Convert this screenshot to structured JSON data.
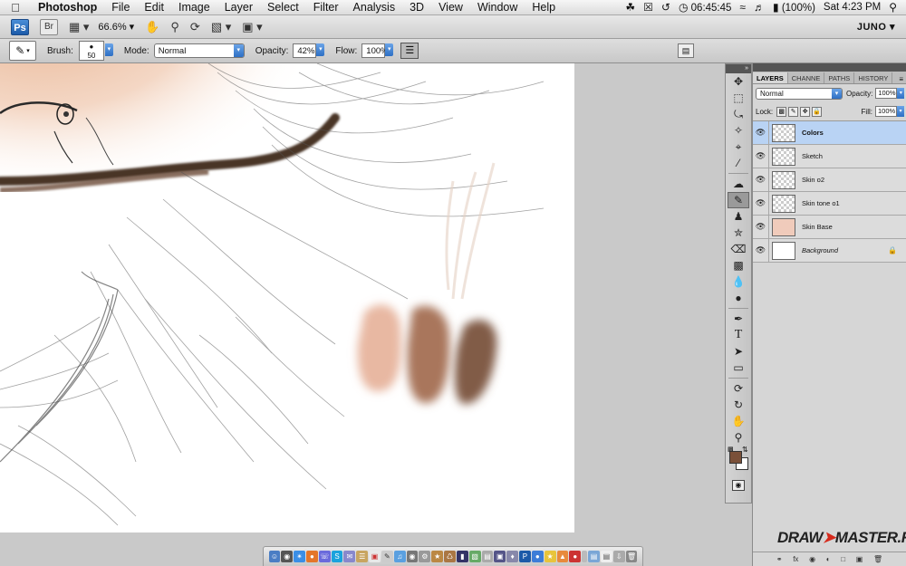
{
  "menubar": {
    "app_name": "Photoshop",
    "menus": [
      "File",
      "Edit",
      "Image",
      "Layer",
      "Select",
      "Filter",
      "Analysis",
      "3D",
      "View",
      "Window",
      "Help"
    ],
    "clock_time": "06:45:45",
    "battery": "(100%)",
    "datetime": "Sat 4:23 PM"
  },
  "appbar": {
    "ps_label": "Ps",
    "br_label": "Br",
    "zoom_level": "66.6%",
    "workspace": "JUNO"
  },
  "options": {
    "brush_label": "Brush:",
    "brush_size": "50",
    "mode_label": "Mode:",
    "mode_value": "Normal",
    "opacity_label": "Opacity:",
    "opacity_value": "42%",
    "flow_label": "Flow:",
    "flow_value": "100%"
  },
  "colors": {
    "foreground": "#7a5039",
    "background": "#ffffff",
    "swatch_light": "#e8b8a2",
    "swatch_mid": "#a9765c",
    "swatch_dark": "#815b47",
    "layer_selected": "#b9d3f4"
  },
  "layers_panel": {
    "tabs": [
      "LAYERS",
      "CHANNE",
      "PATHS",
      "HISTORY"
    ],
    "blend_mode": "Normal",
    "opacity_label": "Opacity:",
    "opacity_value": "100%",
    "lock_label": "Lock:",
    "fill_label": "Fill:",
    "fill_value": "100%",
    "layers": [
      {
        "name": "Colors",
        "selected": true,
        "thumb": "transparent"
      },
      {
        "name": "Sketch",
        "selected": false,
        "thumb": "transparent"
      },
      {
        "name": "Skin o2",
        "selected": false,
        "thumb": "transparent"
      },
      {
        "name": "Skin tone o1",
        "selected": false,
        "thumb": "transparent"
      },
      {
        "name": "Skin Base",
        "selected": false,
        "thumb": "skin"
      },
      {
        "name": "Background",
        "selected": false,
        "thumb": "white",
        "locked": true
      }
    ]
  },
  "tools": [
    "move-tool",
    "marquee-tool",
    "lasso-tool",
    "quick-selection-tool",
    "crop-tool",
    "eyedropper-tool",
    "healing-brush-tool",
    "brush-tool",
    "clone-stamp-tool",
    "history-brush-tool",
    "eraser-tool",
    "gradient-tool",
    "blur-tool",
    "dodge-tool",
    "pen-tool",
    "type-tool",
    "path-selection-tool",
    "shape-tool",
    "3d-rotate-tool",
    "3d-camera-tool",
    "hand-tool",
    "zoom-tool"
  ],
  "watermark": {
    "text_before": "DRAW",
    "text_after": "MASTER.RU"
  }
}
